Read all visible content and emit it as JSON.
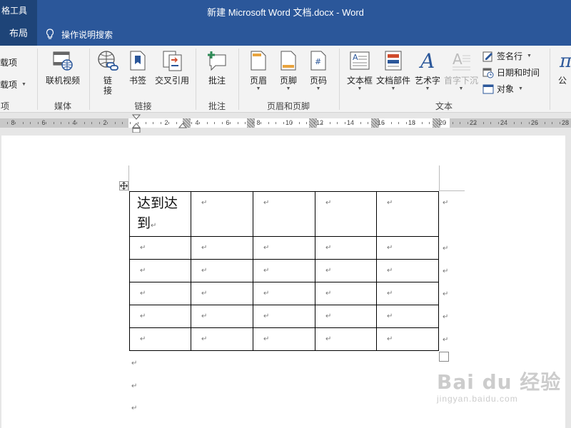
{
  "titlebar": {
    "tools_tab": "格工具",
    "document_title": "新建 Microsoft Word 文档.docx  -  Word"
  },
  "tabs": {
    "layout": "布局",
    "tell_me": "操作说明搜索"
  },
  "ribbon": {
    "addins": {
      "item1": "载项",
      "item2": "载项",
      "group": "项"
    },
    "media": {
      "online_video": "联机视频",
      "group": "媒体"
    },
    "links": {
      "link_line1": "链",
      "link_line2": "接",
      "bookmark": "书签",
      "cross_ref": "交叉引用",
      "group": "链接"
    },
    "comments": {
      "comment": "批注",
      "group": "批注"
    },
    "header_footer": {
      "header": "页眉",
      "footer": "页脚",
      "page_number": "页码",
      "group": "页眉和页脚"
    },
    "text": {
      "text_box": "文本框",
      "quick_parts": "文档部件",
      "wordart": "艺术字",
      "drop_cap": "首字下沉",
      "signature_line": "签名行",
      "date_time": "日期和时间",
      "object": "对象",
      "group": "文本"
    },
    "symbols": {
      "equation": "公"
    }
  },
  "ruler": {
    "left_numbers": [
      "8",
      "6",
      "4",
      "2"
    ],
    "right_numbers": [
      "2",
      "4",
      "6",
      "8",
      "10",
      "12",
      "14",
      "16",
      "18",
      "20",
      "22",
      "24",
      "26",
      "28"
    ]
  },
  "document": {
    "cell_text_line1": "达到达",
    "cell_text_line2": "到",
    "para_mark": "↵"
  },
  "watermark": {
    "logo": "Bai du 经验",
    "url": "jingyan.baidu.com"
  },
  "colors": {
    "title_blue": "#2b579a",
    "tab_dark": "#1e4478",
    "ribbon_bg": "#f3f3f3",
    "accent_orange": "#e8a33d",
    "icon_blue": "#2b579a"
  }
}
